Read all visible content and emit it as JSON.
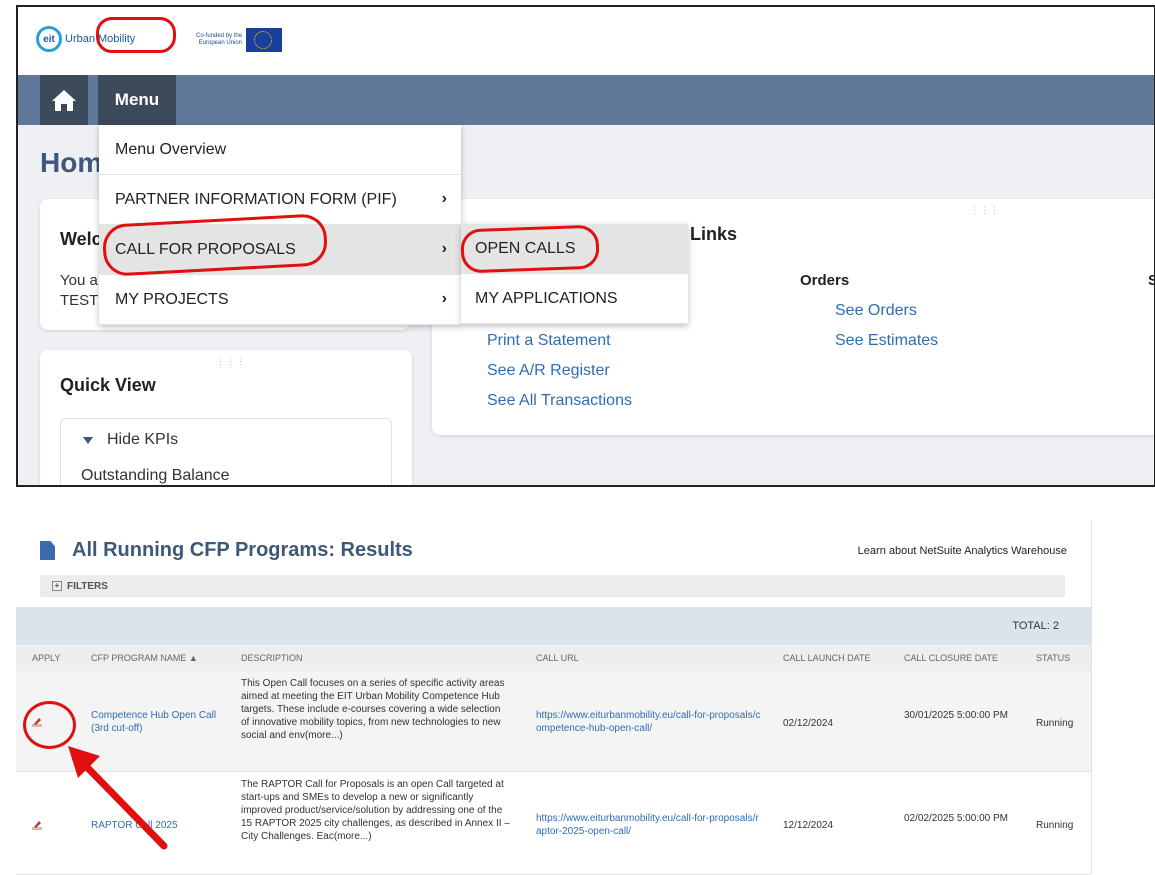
{
  "brand": {
    "logo_letters": "eit",
    "logo_name": "Urban Mobility",
    "eu_credit": "Co-funded by the\nEuropean Union"
  },
  "nav": {
    "menu_label": "Menu"
  },
  "page": {
    "title": "Home"
  },
  "welcome": {
    "title": "Welcome",
    "line1": "You a",
    "line2": "TEST"
  },
  "quick_view": {
    "title": "Quick View",
    "toggle": "Hide KPIs",
    "kpi": "Outstanding Balance"
  },
  "links": {
    "title": "Links",
    "orders_heading": "Orders",
    "s_cut": "S",
    "items": [
      "Print a Statement",
      "See A/R Register",
      "See All Transactions"
    ],
    "orders": [
      "See Orders",
      "See Estimates"
    ]
  },
  "dropdown": {
    "items": [
      {
        "label": "Menu Overview",
        "chevron": ""
      },
      {
        "label": "PARTNER INFORMATION FORM (PIF)",
        "chevron": "›"
      },
      {
        "label": "CALL FOR PROPOSALS",
        "chevron": "›"
      },
      {
        "label": "MY PROJECTS",
        "chevron": "›"
      }
    ],
    "submenu": [
      "OPEN CALLS",
      "MY APPLICATIONS"
    ]
  },
  "results": {
    "title": "All Running CFP Programs: Results",
    "learn": "Learn about NetSuite Analytics Warehouse",
    "filters": "FILTERS",
    "total": "TOTAL: 2",
    "columns": [
      "APPLY",
      "CFP PROGRAM NAME ▲",
      "DESCRIPTION",
      "CALL URL",
      "CALL LAUNCH DATE",
      "CALL CLOSURE DATE",
      "STATUS"
    ],
    "rows": [
      {
        "name": "Competence Hub Open Call (3rd cut-off)",
        "description": "This Open Call focuses on a series of specific activity areas aimed at meeting the EIT Urban Mobility Competence Hub targets. These include e-courses covering a wide selection of innovative mobility topics, from new technologies to new social and env(more...)",
        "url": "https://www.eiturbanmobility.eu/call-for-proposals/competence-hub-open-call/",
        "launch": "02/12/2024",
        "closure": "30/01/2025 5:00:00 PM",
        "status": "Running"
      },
      {
        "name": "RAPTOR Call 2025",
        "description": "The RAPTOR Call for Proposals is an open Call targeted at start-ups and SMEs to develop a new or significantly improved product/service/solution by addressing one of the 15 RAPTOR 2025 city challenges, as described in Annex II – City Challenges. Eac(more...)",
        "url": "https://www.eiturbanmobility.eu/call-for-proposals/raptor-2025-open-call/",
        "launch": "12/12/2024",
        "closure": "02/02/2025 5:00:00 PM",
        "status": "Running"
      }
    ]
  },
  "colors": {
    "nav": "#607899",
    "title": "#3d5878",
    "link": "#2f6db3",
    "annotation": "#e01010"
  }
}
